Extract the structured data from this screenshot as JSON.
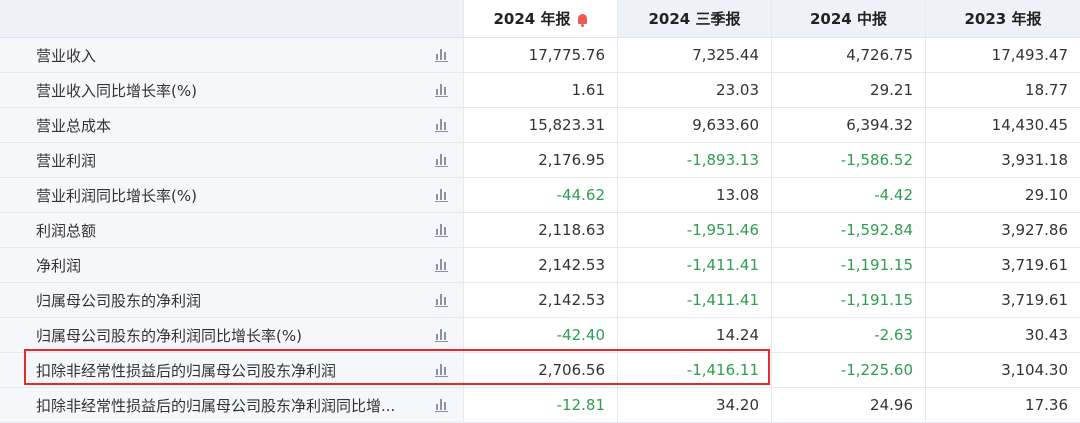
{
  "columns": [
    "2024 年报",
    "2024 三季报",
    "2024 中报",
    "2023 年报"
  ],
  "colors": {
    "negative": "#2e9e4f",
    "alert": "#f05a4e",
    "highlight": "#e32b2b"
  },
  "rows": [
    {
      "label": "营业收入",
      "values": [
        "17,775.76",
        "7,325.44",
        "4,726.75",
        "17,493.47"
      ]
    },
    {
      "label": "营业收入同比增长率(%)",
      "values": [
        "1.61",
        "23.03",
        "29.21",
        "18.77"
      ]
    },
    {
      "label": "营业总成本",
      "values": [
        "15,823.31",
        "9,633.60",
        "6,394.32",
        "14,430.45"
      ]
    },
    {
      "label": "营业利润",
      "values": [
        "2,176.95",
        "-1,893.13",
        "-1,586.52",
        "3,931.18"
      ]
    },
    {
      "label": "营业利润同比增长率(%)",
      "values": [
        "-44.62",
        "13.08",
        "-4.42",
        "29.10"
      ]
    },
    {
      "label": "利润总额",
      "values": [
        "2,118.63",
        "-1,951.46",
        "-1,592.84",
        "3,927.86"
      ]
    },
    {
      "label": "净利润",
      "values": [
        "2,142.53",
        "-1,411.41",
        "-1,191.15",
        "3,719.61"
      ]
    },
    {
      "label": "归属母公司股东的净利润",
      "values": [
        "2,142.53",
        "-1,411.41",
        "-1,191.15",
        "3,719.61"
      ]
    },
    {
      "label": "归属母公司股东的净利润同比增长率(%)",
      "values": [
        "-42.40",
        "14.24",
        "-2.63",
        "30.43"
      ]
    },
    {
      "label": "扣除非经常性损益后的归属母公司股东净利润",
      "values": [
        "2,706.56",
        "-1,416.11",
        "-1,225.60",
        "3,104.30"
      ]
    },
    {
      "label": "扣除非经常性损益后的归属母公司股东净利润同比增...",
      "values": [
        "-12.81",
        "34.20",
        "24.96",
        "17.36"
      ]
    }
  ]
}
